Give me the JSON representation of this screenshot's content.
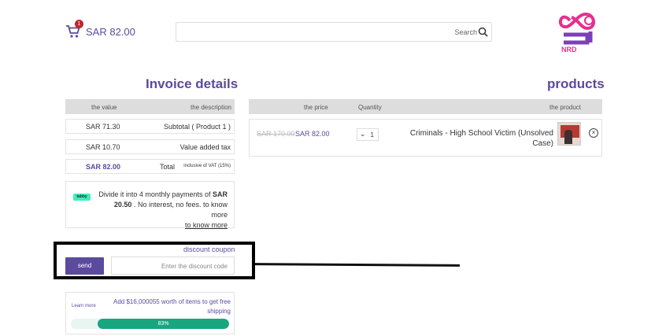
{
  "header": {
    "cart_count": "1",
    "cart_total": "SAR 82.00",
    "search_label": "Search",
    "logo_text": "NRD"
  },
  "invoice": {
    "title": "Invoice details",
    "col_value": "the value",
    "col_description": "the description",
    "rows": [
      {
        "value": "SAR 71.30",
        "label": "Subtotal ( Product 1 )"
      },
      {
        "value": "SAR 10.70",
        "label": "Value added tax"
      },
      {
        "value": "SAR 82.00",
        "label": "Total",
        "note": "inclusive of VAT (15%)"
      }
    ]
  },
  "products": {
    "title": "products",
    "col_price": "the price",
    "col_quantity": "Quantity",
    "col_product": "the product",
    "items": [
      {
        "old_price": "SAR 170.00",
        "price": "SAR 82.00",
        "quantity": "1",
        "name": "Criminals - High School Victim (Unsolved Case)"
      }
    ]
  },
  "tabby": {
    "logo": "tabby",
    "line1": "Divide it into 4 monthly payments of ",
    "amount": "SAR 20.50",
    "line2": " . No interest, no fees. to know more",
    "link": "to know more"
  },
  "coupon": {
    "label": "discount coupon",
    "send": "send",
    "placeholder": "Enter the discount code"
  },
  "shipping": {
    "learn_more": "Learn more",
    "message": "Add $16,000055 worth of items to get free shipping",
    "progress": 0.83,
    "progress_label": "83%"
  },
  "colors": {
    "accent": "#5b4a9e",
    "progress": "#18a67f",
    "badge": "#c0262d"
  }
}
